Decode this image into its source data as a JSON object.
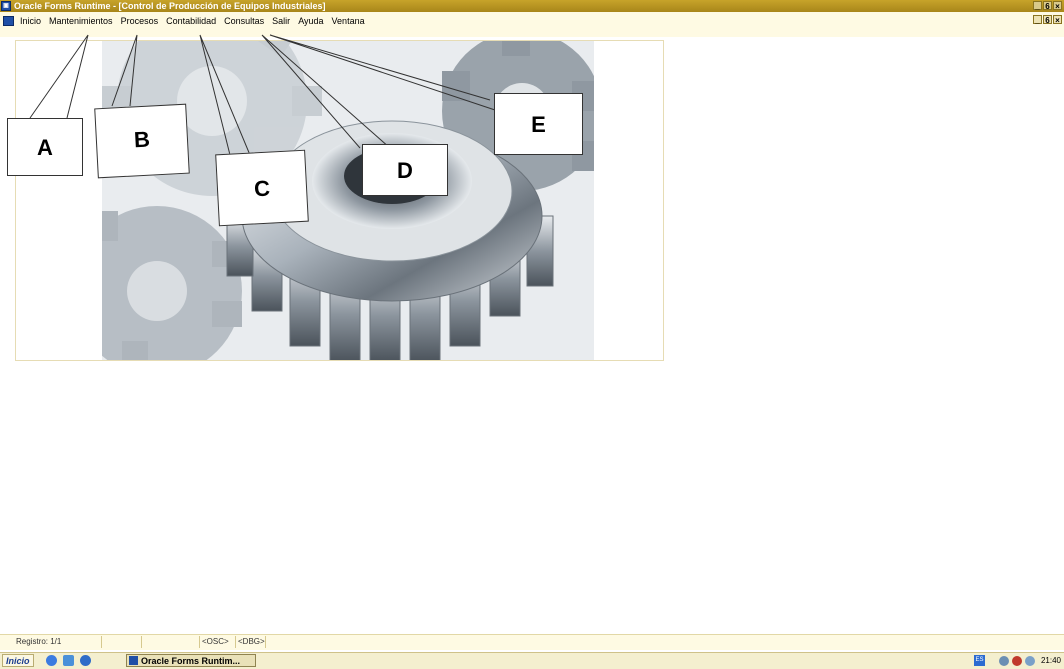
{
  "window": {
    "title": "Oracle Forms Runtime - [Control de Producción de Equipos Industriales]",
    "controls": [
      "_",
      "6",
      "×"
    ]
  },
  "menu": {
    "items": [
      "Inicio",
      "Mantenimientos",
      "Procesos",
      "Contabilidad",
      "Consultas",
      "Salir",
      "Ayuda",
      "Ventana"
    ],
    "mdi_controls": [
      "_",
      "6",
      "×"
    ]
  },
  "callouts": [
    "A",
    "B",
    "C",
    "D",
    "E"
  ],
  "status": {
    "record": "Registro: 1/1",
    "osc": "<OSC>",
    "dbg": "<DBG>"
  },
  "taskbar": {
    "start": "Inicio",
    "task_button": "Oracle Forms Runtim...",
    "language": "ES",
    "clock": "21:40"
  },
  "colors": {
    "titlebar": "#b8951f",
    "menubar": "#fefae3",
    "taskbar": "#f4efcf"
  }
}
